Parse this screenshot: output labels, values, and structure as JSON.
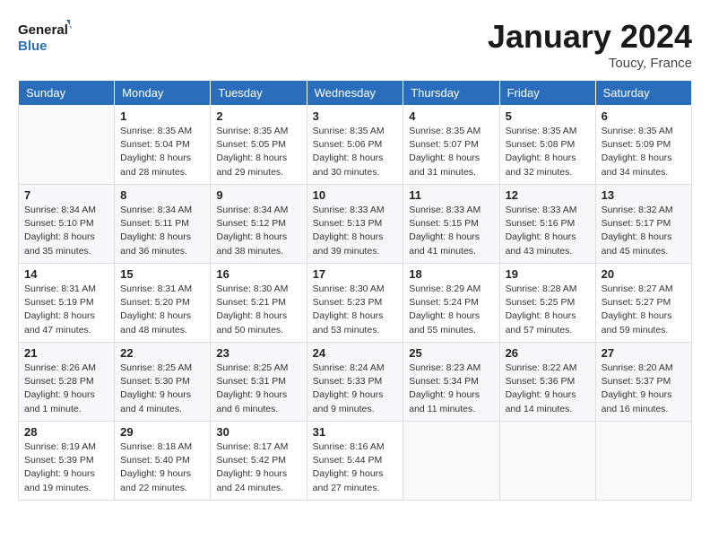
{
  "header": {
    "logo_line1": "General",
    "logo_line2": "Blue",
    "month": "January 2024",
    "location": "Toucy, France"
  },
  "days_of_week": [
    "Sunday",
    "Monday",
    "Tuesday",
    "Wednesday",
    "Thursday",
    "Friday",
    "Saturday"
  ],
  "weeks": [
    [
      {
        "day": "",
        "info": ""
      },
      {
        "day": "1",
        "info": "Sunrise: 8:35 AM\nSunset: 5:04 PM\nDaylight: 8 hours\nand 28 minutes."
      },
      {
        "day": "2",
        "info": "Sunrise: 8:35 AM\nSunset: 5:05 PM\nDaylight: 8 hours\nand 29 minutes."
      },
      {
        "day": "3",
        "info": "Sunrise: 8:35 AM\nSunset: 5:06 PM\nDaylight: 8 hours\nand 30 minutes."
      },
      {
        "day": "4",
        "info": "Sunrise: 8:35 AM\nSunset: 5:07 PM\nDaylight: 8 hours\nand 31 minutes."
      },
      {
        "day": "5",
        "info": "Sunrise: 8:35 AM\nSunset: 5:08 PM\nDaylight: 8 hours\nand 32 minutes."
      },
      {
        "day": "6",
        "info": "Sunrise: 8:35 AM\nSunset: 5:09 PM\nDaylight: 8 hours\nand 34 minutes."
      }
    ],
    [
      {
        "day": "7",
        "info": "Sunrise: 8:34 AM\nSunset: 5:10 PM\nDaylight: 8 hours\nand 35 minutes."
      },
      {
        "day": "8",
        "info": "Sunrise: 8:34 AM\nSunset: 5:11 PM\nDaylight: 8 hours\nand 36 minutes."
      },
      {
        "day": "9",
        "info": "Sunrise: 8:34 AM\nSunset: 5:12 PM\nDaylight: 8 hours\nand 38 minutes."
      },
      {
        "day": "10",
        "info": "Sunrise: 8:33 AM\nSunset: 5:13 PM\nDaylight: 8 hours\nand 39 minutes."
      },
      {
        "day": "11",
        "info": "Sunrise: 8:33 AM\nSunset: 5:15 PM\nDaylight: 8 hours\nand 41 minutes."
      },
      {
        "day": "12",
        "info": "Sunrise: 8:33 AM\nSunset: 5:16 PM\nDaylight: 8 hours\nand 43 minutes."
      },
      {
        "day": "13",
        "info": "Sunrise: 8:32 AM\nSunset: 5:17 PM\nDaylight: 8 hours\nand 45 minutes."
      }
    ],
    [
      {
        "day": "14",
        "info": "Sunrise: 8:31 AM\nSunset: 5:19 PM\nDaylight: 8 hours\nand 47 minutes."
      },
      {
        "day": "15",
        "info": "Sunrise: 8:31 AM\nSunset: 5:20 PM\nDaylight: 8 hours\nand 48 minutes."
      },
      {
        "day": "16",
        "info": "Sunrise: 8:30 AM\nSunset: 5:21 PM\nDaylight: 8 hours\nand 50 minutes."
      },
      {
        "day": "17",
        "info": "Sunrise: 8:30 AM\nSunset: 5:23 PM\nDaylight: 8 hours\nand 53 minutes."
      },
      {
        "day": "18",
        "info": "Sunrise: 8:29 AM\nSunset: 5:24 PM\nDaylight: 8 hours\nand 55 minutes."
      },
      {
        "day": "19",
        "info": "Sunrise: 8:28 AM\nSunset: 5:25 PM\nDaylight: 8 hours\nand 57 minutes."
      },
      {
        "day": "20",
        "info": "Sunrise: 8:27 AM\nSunset: 5:27 PM\nDaylight: 8 hours\nand 59 minutes."
      }
    ],
    [
      {
        "day": "21",
        "info": "Sunrise: 8:26 AM\nSunset: 5:28 PM\nDaylight: 9 hours\nand 1 minute."
      },
      {
        "day": "22",
        "info": "Sunrise: 8:25 AM\nSunset: 5:30 PM\nDaylight: 9 hours\nand 4 minutes."
      },
      {
        "day": "23",
        "info": "Sunrise: 8:25 AM\nSunset: 5:31 PM\nDaylight: 9 hours\nand 6 minutes."
      },
      {
        "day": "24",
        "info": "Sunrise: 8:24 AM\nSunset: 5:33 PM\nDaylight: 9 hours\nand 9 minutes."
      },
      {
        "day": "25",
        "info": "Sunrise: 8:23 AM\nSunset: 5:34 PM\nDaylight: 9 hours\nand 11 minutes."
      },
      {
        "day": "26",
        "info": "Sunrise: 8:22 AM\nSunset: 5:36 PM\nDaylight: 9 hours\nand 14 minutes."
      },
      {
        "day": "27",
        "info": "Sunrise: 8:20 AM\nSunset: 5:37 PM\nDaylight: 9 hours\nand 16 minutes."
      }
    ],
    [
      {
        "day": "28",
        "info": "Sunrise: 8:19 AM\nSunset: 5:39 PM\nDaylight: 9 hours\nand 19 minutes."
      },
      {
        "day": "29",
        "info": "Sunrise: 8:18 AM\nSunset: 5:40 PM\nDaylight: 9 hours\nand 22 minutes."
      },
      {
        "day": "30",
        "info": "Sunrise: 8:17 AM\nSunset: 5:42 PM\nDaylight: 9 hours\nand 24 minutes."
      },
      {
        "day": "31",
        "info": "Sunrise: 8:16 AM\nSunset: 5:44 PM\nDaylight: 9 hours\nand 27 minutes."
      },
      {
        "day": "",
        "info": ""
      },
      {
        "day": "",
        "info": ""
      },
      {
        "day": "",
        "info": ""
      }
    ]
  ]
}
